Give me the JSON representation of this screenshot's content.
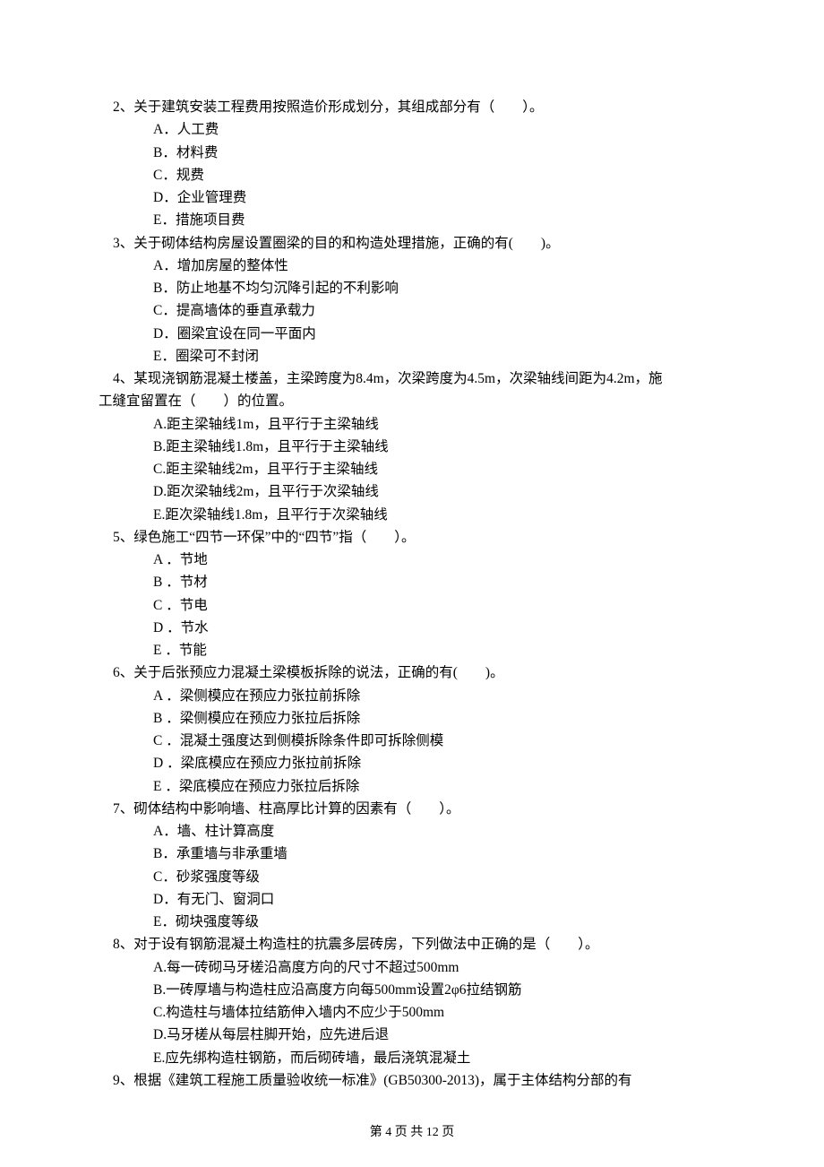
{
  "questions": [
    {
      "num": "2",
      "stem": "2、关于建筑安装工程费用按照造价形成划分，其组成部分有（　　）。",
      "opts": [
        "A．人工费",
        "B．材料费",
        "C．规费",
        "D．企业管理费",
        "E．措施项目费"
      ]
    },
    {
      "num": "3",
      "stem": "3、关于砌体结构房屋设置圈梁的目的和构造处理措施，正确的有(　　)。",
      "opts": [
        "A．增加房屋的整体性",
        "B．防止地基不均匀沉降引起的不利影响",
        "C．提高墙体的垂直承载力",
        "D．圈梁宜设在同一平面内",
        "E．圈梁可不封闭"
      ]
    },
    {
      "num": "4",
      "stem": "4、某现浇钢筋混凝土楼盖，主梁跨度为8.4m，次梁跨度为4.5m，次梁轴线间距为4.2m，施工缝宜留置在（　　）的位置。",
      "opts": [
        "A.距主梁轴线1m，且平行于主梁轴线",
        "B.距主梁轴线1.8m，且平行于主梁轴线",
        "C.距主梁轴线2m，且平行于主梁轴线",
        "D.距次梁轴线2m，且平行于次梁轴线",
        "E.距次梁轴线1.8m，且平行于次梁轴线"
      ],
      "opt_style": "tight"
    },
    {
      "num": "5",
      "stem": "5、绿色施工“四节一环保”中的“四节”指（　　）。",
      "opts": [
        "A ．节地",
        "B ．节材",
        "C ．节电",
        "D ．节水",
        "E ．节能"
      ]
    },
    {
      "num": "6",
      "stem": "6、关于后张预应力混凝土梁模板拆除的说法，正确的有(　　)。",
      "opts": [
        "A ．梁侧模应在预应力张拉前拆除",
        "B ．梁侧模应在预应力张拉后拆除",
        "C ．混凝土强度达到侧模拆除条件即可拆除侧模",
        "D ．梁底模应在预应力张拉前拆除",
        "E ．梁底模应在预应力张拉后拆除"
      ]
    },
    {
      "num": "7",
      "stem": "7、砌体结构中影响墙、柱高厚比计算的因素有（　　）。",
      "opts": [
        "A．墙、柱计算高度",
        "B．承重墙与非承重墙",
        "C．砂浆强度等级",
        "D．有无门、窗洞口",
        "E．砌块强度等级"
      ]
    },
    {
      "num": "8",
      "stem": "8、对于设有钢筋混凝土构造柱的抗震多层砖房，下列做法中正确的是（　　）。",
      "opts": [
        "A.每一砖砌马牙槎沿高度方向的尺寸不超过500mm",
        "B.一砖厚墙与构造柱应沿高度方向每500mm设置2φ6拉结钢筋",
        "C.构造柱与墙体拉结筋伸入墙内不应少于500mm",
        "D.马牙槎从每层柱脚开始，应先进后退",
        "E.应先绑构造柱钢筋，而后砌砖墙，最后浇筑混凝土"
      ],
      "opt_style": "tight"
    },
    {
      "num": "9",
      "stem": "9、根据《建筑工程施工质量验收统一标准》(GB50300-2013)，属于主体结构分部的有",
      "opts": []
    }
  ],
  "footer": {
    "prefix": "第 ",
    "current": "4",
    "middle": " 页 共 ",
    "total": "12",
    "suffix": " 页"
  }
}
